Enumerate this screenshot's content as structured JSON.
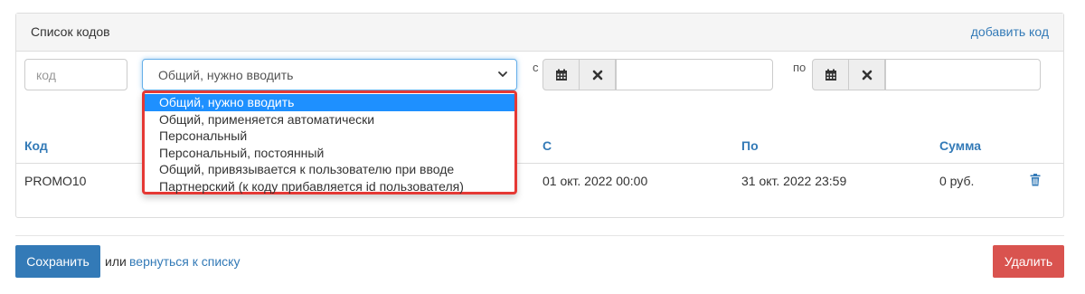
{
  "panel": {
    "title": "Список кодов",
    "add_link": "добавить код"
  },
  "filters": {
    "code_placeholder": "код",
    "type_selected": "Общий, нужно вводить",
    "from_label": "с",
    "to_label": "по"
  },
  "dropdown": {
    "options": [
      "Общий, нужно вводить",
      "Общий, применяется автоматически",
      "Персональный",
      "Персональный, постоянный",
      "Общий, привязывается к пользователю при вводе",
      "Партнерский (к коду прибавляется id пользователя)"
    ],
    "selected_index": 0,
    "highlight_color": "#e53935"
  },
  "table": {
    "headers": [
      "Код",
      "С",
      "По",
      "Сумма"
    ],
    "rows": [
      {
        "code": "PROMO10",
        "from": "01 окт. 2022 00:00",
        "to": "31 окт. 2022 23:59",
        "sum": "0 руб."
      }
    ]
  },
  "footer": {
    "save": "Сохранить",
    "or": "или",
    "back": "вернуться к списку",
    "delete": "Удалить"
  },
  "colors": {
    "link": "#337ab7",
    "primary": "#337ab7",
    "danger": "#d9534f",
    "selected_option": "#1e90ff"
  },
  "icons": [
    "calendar-icon",
    "close-icon",
    "trash-icon",
    "chevron-down-icon"
  ]
}
